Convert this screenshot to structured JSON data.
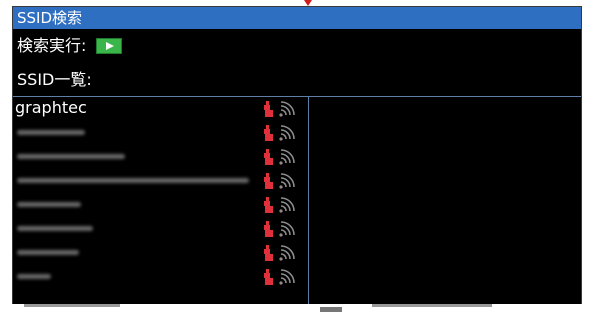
{
  "window": {
    "title": "SSID検索"
  },
  "scan": {
    "label": "検索実行:",
    "button_icon": "play-icon",
    "button_color": "#39b54a"
  },
  "list": {
    "label": "SSID一覧:",
    "items": [
      {
        "name": "graphtec",
        "secured": true,
        "signal_icon": "wifi-signal-icon"
      },
      {
        "name": "",
        "secured": true,
        "signal_icon": "wifi-signal-icon",
        "obscured": true
      },
      {
        "name": "",
        "secured": true,
        "signal_icon": "wifi-signal-icon",
        "obscured": true
      },
      {
        "name": "",
        "secured": true,
        "signal_icon": "wifi-signal-icon",
        "obscured": true
      },
      {
        "name": "",
        "secured": true,
        "signal_icon": "wifi-signal-icon",
        "obscured": true
      },
      {
        "name": "",
        "secured": true,
        "signal_icon": "wifi-signal-icon",
        "obscured": true
      },
      {
        "name": "",
        "secured": true,
        "signal_icon": "wifi-signal-icon",
        "obscured": true
      },
      {
        "name": "",
        "secured": true,
        "signal_icon": "wifi-signal-icon",
        "obscured": true
      }
    ]
  },
  "colors": {
    "titlebar": "#2f6fc2",
    "lock": "#e0303a",
    "signal": "#8c8c8c"
  }
}
